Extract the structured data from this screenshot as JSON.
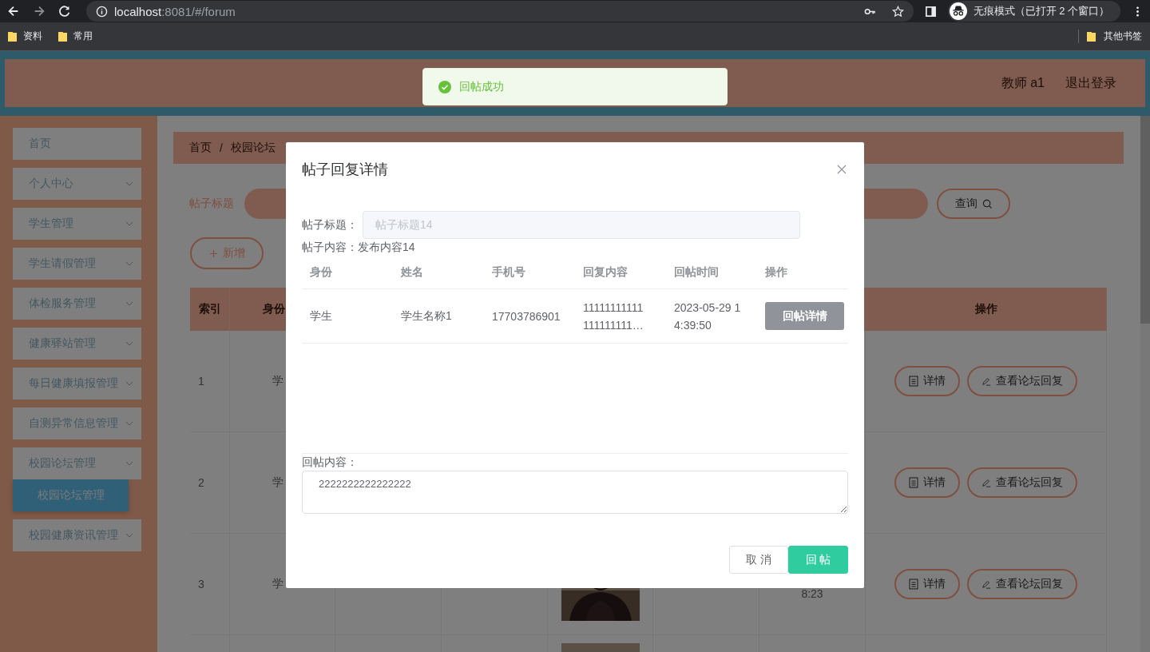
{
  "browser": {
    "url_host": "localhost",
    "url_path": ":8081/#/forum",
    "incognito": "无痕模式（已打开 2 个窗口）",
    "bookmarks": [
      "资料",
      "常用"
    ],
    "other_bookmarks": "其他书签"
  },
  "header": {
    "user": "教师 a1",
    "logout": "退出登录"
  },
  "toast": {
    "kind": "success",
    "text": "回帖成功"
  },
  "sidebar": {
    "items": [
      {
        "label": "首页",
        "kind": "link"
      },
      {
        "label": "个人中心",
        "kind": "submenu"
      },
      {
        "label": "学生管理",
        "kind": "submenu"
      },
      {
        "label": "学生请假管理",
        "kind": "submenu"
      },
      {
        "label": "体检服务管理",
        "kind": "submenu"
      },
      {
        "label": "健康驿站管理",
        "kind": "submenu"
      },
      {
        "label": "每日健康填报管理",
        "kind": "submenu"
      },
      {
        "label": "自测异常信息管理",
        "kind": "submenu"
      },
      {
        "label": "校园论坛管理",
        "kind": "submenu",
        "children": [
          {
            "label": "校园论坛管理",
            "selected": true
          }
        ]
      },
      {
        "label": "校园健康资讯管理",
        "kind": "submenu"
      }
    ]
  },
  "breadcrumb": {
    "items": [
      "首页",
      "校园论坛"
    ],
    "separator": "/"
  },
  "search": {
    "label": "帖子标题",
    "button": "查询"
  },
  "add_button": "新增",
  "table": {
    "columns": [
      "索引",
      "身份",
      "操作"
    ],
    "rows": [
      {
        "index": "1",
        "identity": "学",
        "actions": [
          "详情",
          "查看论坛回复"
        ]
      },
      {
        "index": "2",
        "identity": "学",
        "actions": [
          "详情",
          "查看论坛回复"
        ]
      },
      {
        "index": "3",
        "identity": "学",
        "picture": true,
        "time": "8:23",
        "actions": [
          "详情",
          "查看论坛回复"
        ]
      },
      {
        "picture": true
      }
    ]
  },
  "modal": {
    "title": "帖子回复详情",
    "title_field": {
      "label": "帖子标题：",
      "value": "帖子标题14",
      "disabled": true
    },
    "content": {
      "label": "帖子内容：",
      "value": "发布内容14"
    },
    "replies": {
      "columns": [
        "身份",
        "姓名",
        "手机号",
        "回复内容",
        "回帖时间",
        "操作"
      ],
      "rows": [
        {
          "identity": "学生",
          "name": "学生名称1",
          "phone": "17703786901",
          "content": "11111111111\n111111111…",
          "time": "2023-05-29 1\n4:39:50",
          "action": "回帖详情"
        }
      ]
    },
    "reply_field": {
      "label": "回帖内容：",
      "value": "2222222222222222"
    },
    "buttons": [
      {
        "label": "取 消",
        "kind": "default"
      },
      {
        "label": "回 帖",
        "kind": "primary"
      }
    ]
  }
}
